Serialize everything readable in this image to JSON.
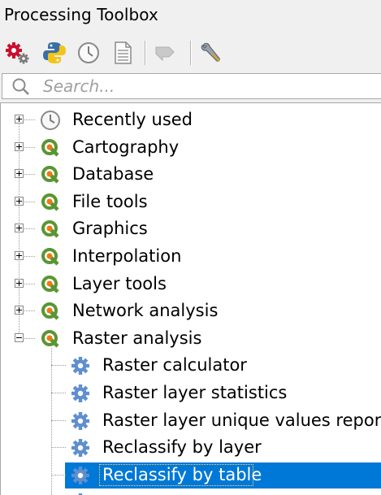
{
  "window": {
    "title": "Processing Toolbox"
  },
  "toolbar": {
    "buttons": [
      {
        "icon": "models-gear-icon"
      },
      {
        "icon": "python-icon"
      },
      {
        "icon": "history-clock-icon"
      },
      {
        "icon": "results-document-icon"
      },
      {
        "icon": "edit-features-in-place-icon",
        "disabled": true
      },
      {
        "icon": "options-wrench-icon"
      }
    ]
  },
  "search": {
    "placeholder": "Search..."
  },
  "tree": {
    "groups": [
      {
        "label": "Recently used",
        "icon": "clock-icon",
        "expanded": false
      },
      {
        "label": "Cartography",
        "icon": "qgis-icon",
        "expanded": false
      },
      {
        "label": "Database",
        "icon": "qgis-icon",
        "expanded": false
      },
      {
        "label": "File tools",
        "icon": "qgis-icon",
        "expanded": false
      },
      {
        "label": "Graphics",
        "icon": "qgis-icon",
        "expanded": false
      },
      {
        "label": "Interpolation",
        "icon": "qgis-icon",
        "expanded": false
      },
      {
        "label": "Layer tools",
        "icon": "qgis-icon",
        "expanded": false
      },
      {
        "label": "Network analysis",
        "icon": "qgis-icon",
        "expanded": false
      },
      {
        "label": "Raster analysis",
        "icon": "qgis-icon",
        "expanded": true
      }
    ],
    "raster_children": [
      {
        "label": "Raster calculator",
        "icon": "algorithm-gear-icon",
        "selected": false
      },
      {
        "label": "Raster layer statistics",
        "icon": "algorithm-gear-icon",
        "selected": false
      },
      {
        "label": "Raster layer unique values report",
        "icon": "algorithm-gear-icon",
        "selected": false
      },
      {
        "label": "Reclassify by layer",
        "icon": "algorithm-gear-icon",
        "selected": false
      },
      {
        "label": "Reclassify by table",
        "icon": "algorithm-gear-icon",
        "selected": true
      }
    ]
  },
  "colors": {
    "selection": "#0078d7",
    "qgis_green": "#589632",
    "qgis_orange": "#ee7913",
    "gear_blue": "#5f8fd0"
  }
}
